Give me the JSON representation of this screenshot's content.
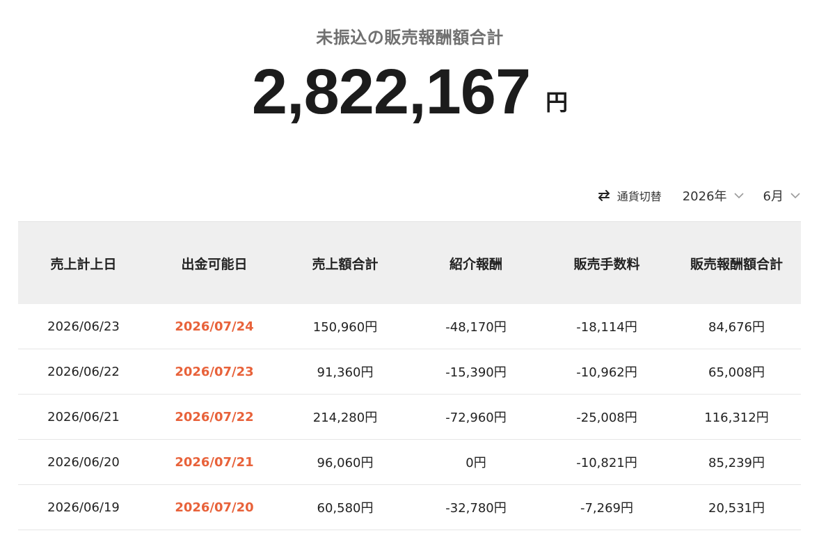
{
  "summary": {
    "title": "未振込の販売報酬額合計",
    "amount": "2,822,167",
    "unit": "円"
  },
  "controls": {
    "currency_toggle_label": "通貨切替",
    "year_value": "2026年",
    "month_value": "6月"
  },
  "icons": {
    "currency_toggle": "swap-arrows-icon",
    "dropdown": "chevron-down-icon"
  },
  "colors": {
    "withdraw_date": "#e8623a",
    "header_bg": "#efefef"
  },
  "table": {
    "headers": [
      "売上計上日",
      "出金可能日",
      "売上額合計",
      "紹介報酬",
      "販売手数料",
      "販売報酬額合計"
    ],
    "rows": [
      [
        "2026/06/23",
        "2026/07/24",
        "150,960円",
        "-48,170円",
        "-18,114円",
        "84,676円"
      ],
      [
        "2026/06/22",
        "2026/07/23",
        "91,360円",
        "-15,390円",
        "-10,962円",
        "65,008円"
      ],
      [
        "2026/06/21",
        "2026/07/22",
        "214,280円",
        "-72,960円",
        "-25,008円",
        "116,312円"
      ],
      [
        "2026/06/20",
        "2026/07/21",
        "96,060円",
        "0円",
        "-10,821円",
        "85,239円"
      ],
      [
        "2026/06/19",
        "2026/07/20",
        "60,580円",
        "-32,780円",
        "-7,269円",
        "20,531円"
      ]
    ]
  }
}
